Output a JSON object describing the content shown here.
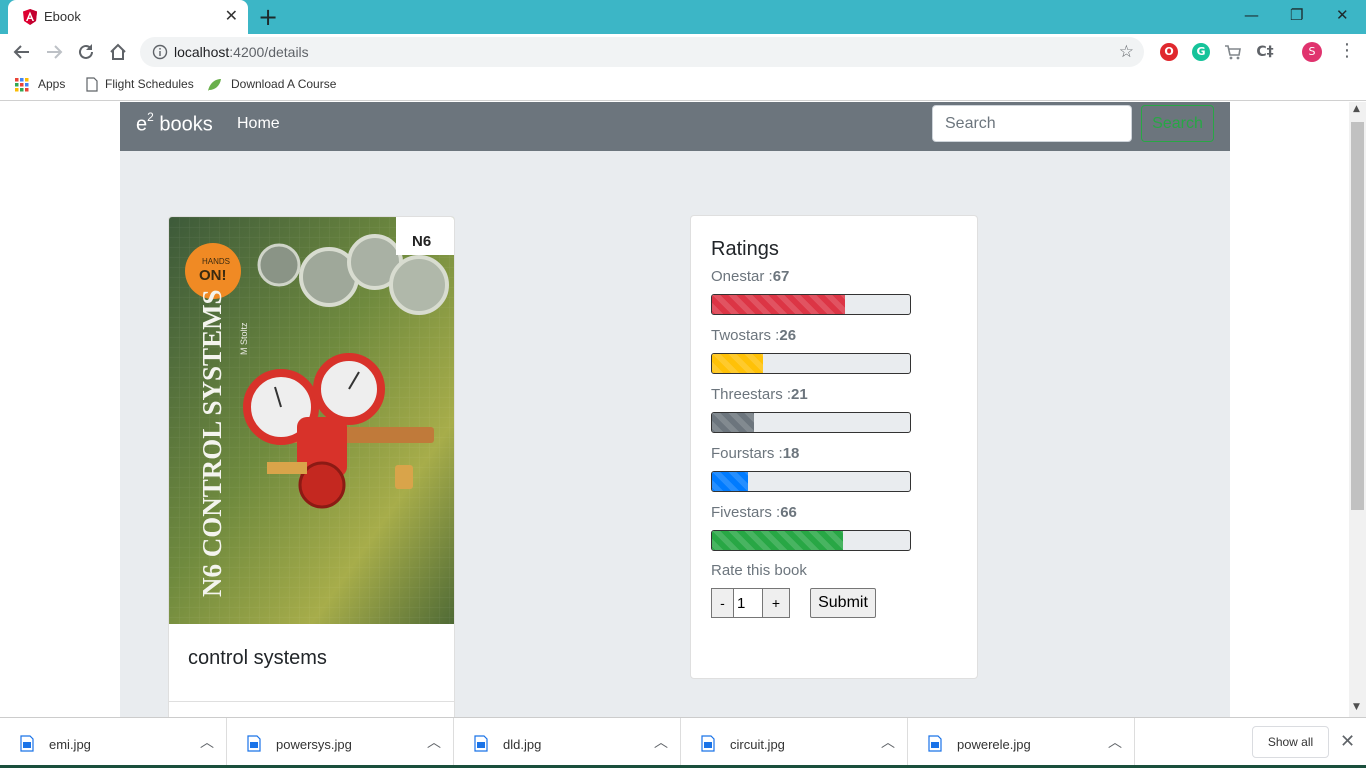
{
  "browser": {
    "tab_title": "Ebook",
    "new_tab_symbol": "+",
    "url_host": "localhost",
    "url_path": ":4200/details",
    "profile_initial": "S",
    "window_controls": {
      "minimize": "—",
      "restore": "❐",
      "close": "✕"
    }
  },
  "bookmarks": [
    {
      "label": "Apps"
    },
    {
      "label": "Flight Schedules"
    },
    {
      "label": "Download A Course"
    }
  ],
  "navbar": {
    "brand_prefix": "e",
    "brand_sup": "2",
    "brand_suffix": "books",
    "home_label": "Home",
    "search_placeholder": "Search",
    "search_button": "Search"
  },
  "book": {
    "title": "control systems",
    "cover": {
      "badge": "HANDS ON!",
      "badge_top": "HANDS",
      "badge_bottom": "ON!",
      "level": "N6",
      "title_text": "N6 CONTROL SYSTEMS",
      "author": "M Stoltz"
    }
  },
  "ratings": {
    "title": "Ratings",
    "rows": [
      {
        "label": "Onestar :",
        "value": "67",
        "color": "#dc3545"
      },
      {
        "label": "Twostars :",
        "value": "26",
        "color": "#ffc107"
      },
      {
        "label": "Threestars :",
        "value": "21",
        "color": "#6c757d"
      },
      {
        "label": "Fourstars :",
        "value": "18",
        "color": "#007bff"
      },
      {
        "label": "Fivestars :",
        "value": "66",
        "color": "#28a745"
      }
    ],
    "rate_label": "Rate this book",
    "minus": "-",
    "plus": "+",
    "rate_value": "1",
    "submit": "Submit"
  },
  "downloads": {
    "items": [
      {
        "name": "emi.jpg"
      },
      {
        "name": "powersys.jpg"
      },
      {
        "name": "dld.jpg"
      },
      {
        "name": "circuit.jpg"
      },
      {
        "name": "powerele.jpg"
      }
    ],
    "show_all": "Show all"
  }
}
